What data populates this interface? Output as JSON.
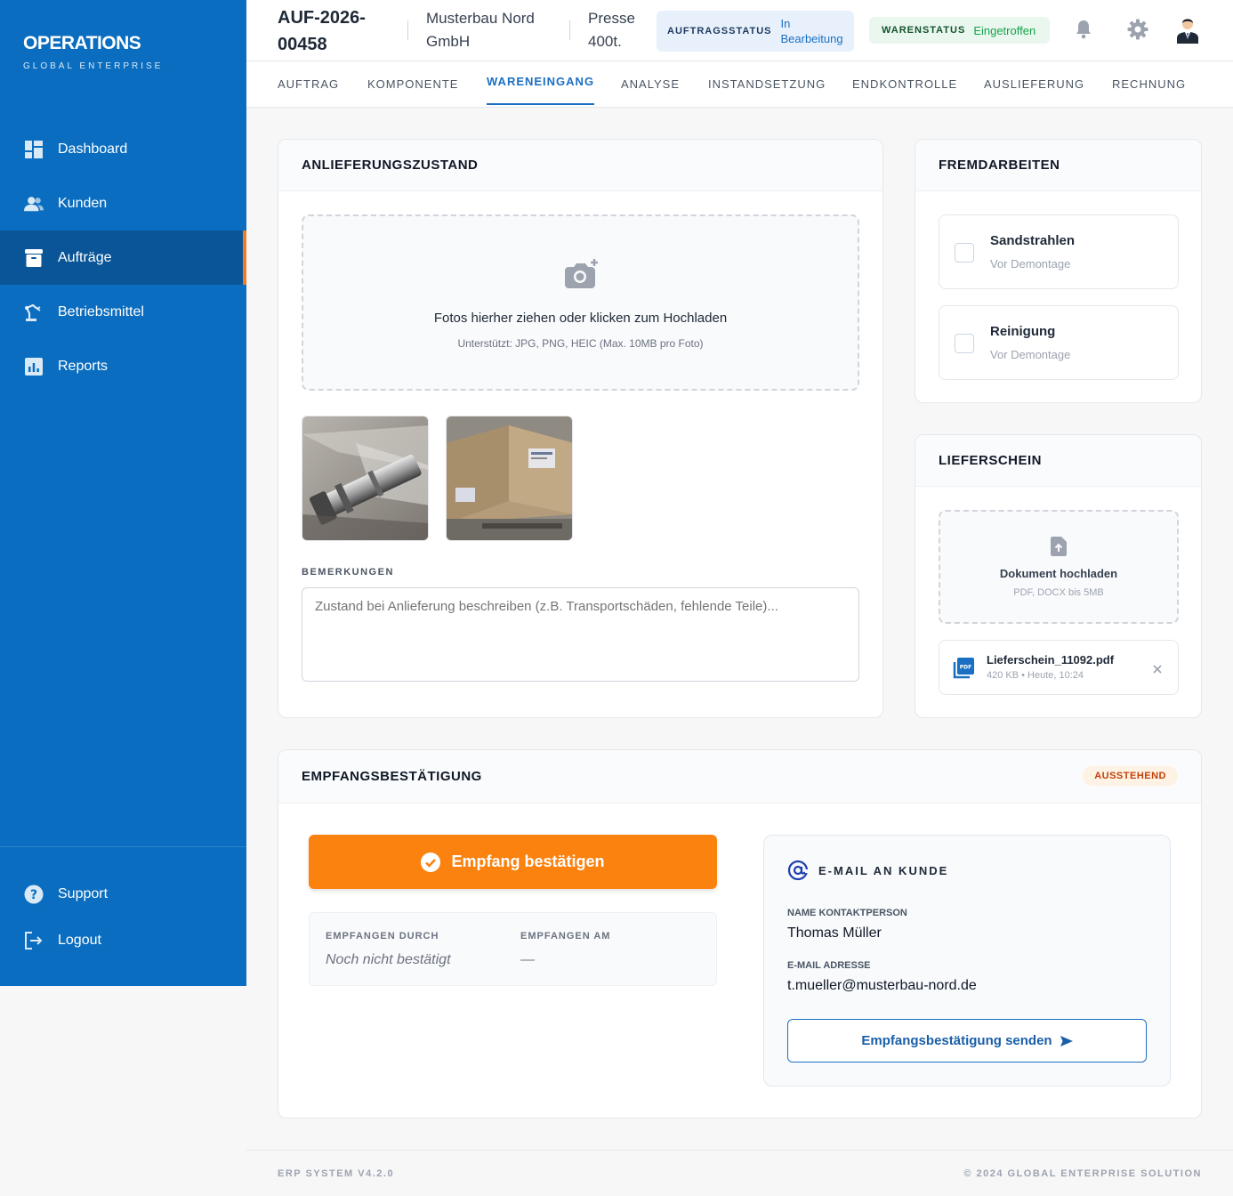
{
  "brand": {
    "title": "OPERATIONS",
    "subtitle": "GLOBAL ENTERPRISE"
  },
  "sidebar": {
    "items": [
      {
        "label": "Dashboard",
        "icon": "dashboard-icon"
      },
      {
        "label": "Kunden",
        "icon": "users-icon"
      },
      {
        "label": "Aufträge",
        "icon": "archive-icon",
        "active": true
      },
      {
        "label": "Betriebsmittel",
        "icon": "robot-arm-icon"
      },
      {
        "label": "Reports",
        "icon": "chart-icon"
      }
    ],
    "bottom": [
      {
        "label": "Support",
        "icon": "help-icon"
      },
      {
        "label": "Logout",
        "icon": "logout-icon"
      }
    ]
  },
  "header": {
    "order_id": "AUF-2026-00458",
    "company": "Musterbau Nord GmbH",
    "machine": "Presse 400t.",
    "order_status_label": "AUFTRAGSSTATUS",
    "order_status_value": "In Bearbeitung",
    "goods_status_label": "WARENSTATUS",
    "goods_status_value": "Eingetroffen"
  },
  "tabs": [
    "AUFTRAG",
    "KOMPONENTE",
    "WARENEINGANG",
    "ANALYSE",
    "INSTANDSETZUNG",
    "ENDKONTROLLE",
    "AUSLIEFERUNG",
    "RECHNUNG"
  ],
  "active_tab": "WARENEINGANG",
  "delivery_condition": {
    "title": "ANLIEFERUNGSZUSTAND",
    "dropzone_text": "Fotos hierher ziehen oder klicken zum Hochladen",
    "dropzone_hint": "Unterstützt: JPG, PNG, HEIC (Max. 10MB pro Foto)",
    "remarks_label": "BEMERKUNGEN",
    "remarks_placeholder": "Zustand bei Anlieferung beschreiben (z.B. Transportschäden, fehlende Teile)..."
  },
  "external_work": {
    "title": "FREMDARBEITEN",
    "items": [
      {
        "name": "Sandstrahlen",
        "sub": "Vor Demontage",
        "checked": false
      },
      {
        "name": "Reinigung",
        "sub": "Vor Demontage",
        "checked": false
      }
    ]
  },
  "delivery_note": {
    "title": "LIEFERSCHEIN",
    "upload_text": "Dokument hochladen",
    "upload_hint": "PDF, DOCX bis 5MB",
    "file_name": "Lieferschein_11092.pdf",
    "file_meta": "420 KB • Heute, 10:24"
  },
  "receipt": {
    "title": "EMPFANGSBESTÄTIGUNG",
    "status": "AUSSTEHEND",
    "confirm_button": "Empfang bestätigen",
    "received_by_label": "EMPFANGEN DURCH",
    "received_by_value": "Noch nicht bestätigt",
    "received_at_label": "EMPFANGEN AM",
    "received_at_value": "—",
    "mail_title": "E-MAIL AN KUNDE",
    "contact_label": "NAME KONTAKTPERSON",
    "contact_value": "Thomas Müller",
    "email_label": "E-MAIL ADRESSE",
    "email_value": "t.mueller@musterbau-nord.de",
    "send_button": "Empfangsbestätigung senden"
  },
  "footer": {
    "left": "ERP SYSTEM V4.2.0",
    "right": "© 2024 GLOBAL ENTERPRISE SOLUTION"
  },
  "colors": {
    "sidebar": "#0a6dbf",
    "accent": "#fb820f",
    "primary": "#1a6fc2"
  }
}
